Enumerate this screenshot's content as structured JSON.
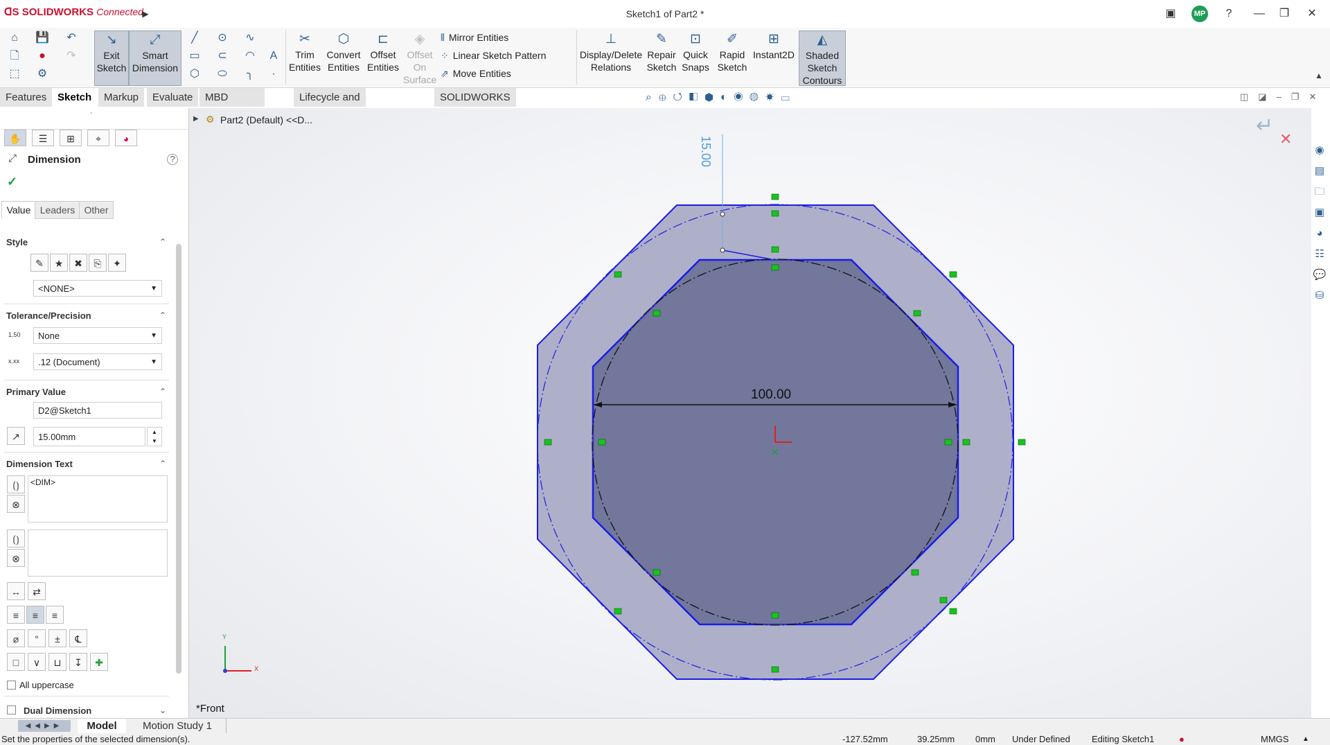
{
  "app": {
    "brand": "SOLIDWORKS",
    "brand_suffix": "Connected",
    "window_title": "Sketch1 of Part2 *",
    "user_initials": "MP"
  },
  "commands": {
    "exit_sketch": "Exit Sketch",
    "smart_dimension": "Smart Dimension",
    "trim_entities": "Trim Entities",
    "convert_entities": "Convert Entities",
    "offset_entities": "Offset Entities",
    "offset_on_surface": "Offset On Surface",
    "mirror_entities": "Mirror Entities",
    "linear_sketch_pattern": "Linear Sketch Pattern",
    "move_entities": "Move Entities",
    "display_delete_relations": "Display/Delete Relations",
    "repair_sketch": "Repair Sketch",
    "quick_snaps": "Quick Snaps",
    "rapid_sketch": "Rapid Sketch",
    "instant2d": "Instant2D",
    "shaded_sketch_contours": "Shaded Sketch Contours"
  },
  "tabs": [
    "Features",
    "Sketch",
    "Markup",
    "Evaluate",
    "MBD Dimensions",
    "Lifecycle and Collaboration",
    "SOLIDWORKS Add-Ins"
  ],
  "active_tab": "Sketch",
  "tree": {
    "part_label": "Part2 (Default) <<D..."
  },
  "panel": {
    "title": "Dimension",
    "subtabs": [
      "Value",
      "Leaders",
      "Other"
    ],
    "style": {
      "title": "Style",
      "dropdown": "<NONE>"
    },
    "tolerance": {
      "title": "Tolerance/Precision",
      "tolerance_type": "None",
      "precision": ".12 (Document)"
    },
    "primary": {
      "title": "Primary Value",
      "name": "D2@Sketch1",
      "value": "15.00mm"
    },
    "dimtext": {
      "title": "Dimension Text",
      "text": "<DIM>"
    },
    "all_uppercase": "All uppercase",
    "dual_dimension": "Dual Dimension"
  },
  "sketch": {
    "diameter_label": "100.00",
    "offset_label": "15.00",
    "view_label": "*Front",
    "axis_x": "X",
    "axis_y": "Y"
  },
  "bottom_tabs": [
    "Model",
    "Motion Study 1"
  ],
  "status": {
    "message": "Set the properties of the selected dimension(s).",
    "x": "-127.52mm",
    "y": "39.25mm",
    "z": "0mm",
    "state": "Under Defined",
    "editing": "Editing Sketch1",
    "units": "MMGS"
  },
  "colors": {
    "sketch_blue": "#1b1be6",
    "fill_outer": "#aeb0c9",
    "fill_inner": "#72779c",
    "accent_red": "#c8102e"
  }
}
